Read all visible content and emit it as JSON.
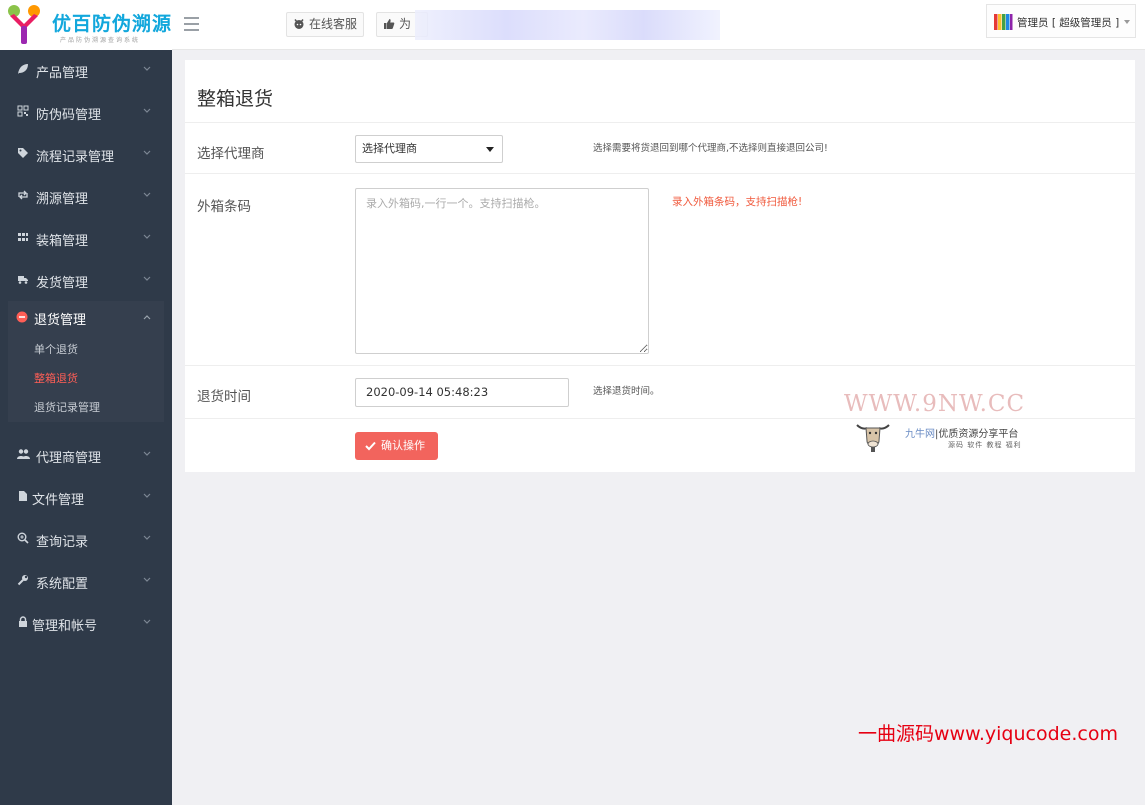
{
  "brand": {
    "title": "优百防伪溯源",
    "subtitle": "产品防伪溯源查询系统"
  },
  "topbar": {
    "service_label": "在线客服",
    "like_label": "为",
    "user_label": "管理员 [ 超级管理员 ]"
  },
  "sidebar": {
    "items_top": [
      {
        "label": "产品管理",
        "icon": "leaf-icon"
      },
      {
        "label": "防伪码管理",
        "icon": "qrcode-icon"
      },
      {
        "label": "流程记录管理",
        "icon": "tag-icon"
      },
      {
        "label": "溯源管理",
        "icon": "retweet-icon"
      },
      {
        "label": "装箱管理",
        "icon": "grid-icon"
      },
      {
        "label": "发货管理",
        "icon": "truck-icon"
      }
    ],
    "open_group": {
      "label": "退货管理",
      "icon": "minus-circle-icon",
      "children": [
        {
          "label": "单个退货",
          "active": false
        },
        {
          "label": "整箱退货",
          "active": true
        },
        {
          "label": "退货记录管理",
          "active": false
        }
      ]
    },
    "items_bottom": [
      {
        "label": "代理商管理",
        "icon": "users-icon"
      },
      {
        "label": "文件管理",
        "icon": "file-icon"
      },
      {
        "label": "查询记录",
        "icon": "search-plus-icon"
      },
      {
        "label": "系统配置",
        "icon": "wrench-icon"
      },
      {
        "label": "管理和帐号",
        "icon": "lock-icon"
      }
    ]
  },
  "page": {
    "title": "整箱退货",
    "agent": {
      "label": "选择代理商",
      "selected": "选择代理商",
      "hint": "选择需要将货退回到哪个代理商,不选择则直接退回公司!"
    },
    "barcode": {
      "label": "外箱条码",
      "placeholder": "录入外箱码,一行一个。支持扫描枪。",
      "value": "",
      "hint": "录入外箱条码，支持扫描枪!"
    },
    "return_time": {
      "label": "退货时间",
      "value": "2020-09-14 05:48:23",
      "hint": "选择退货时间。"
    },
    "confirm_label": "确认操作"
  },
  "watermarks": {
    "site": "WWW.9NW.CC",
    "name_brand": "九牛网",
    "name_rest": "|优质资源分享平台",
    "tags": "源码 软件 教程 福利",
    "bottom": "一曲源码www.yiqucode.com"
  },
  "colors": {
    "sidebar_bg": "#2f3a49",
    "accent_red": "#f2645d",
    "active_sub": "#ff5e56",
    "logo_blue": "#12a7dc"
  }
}
